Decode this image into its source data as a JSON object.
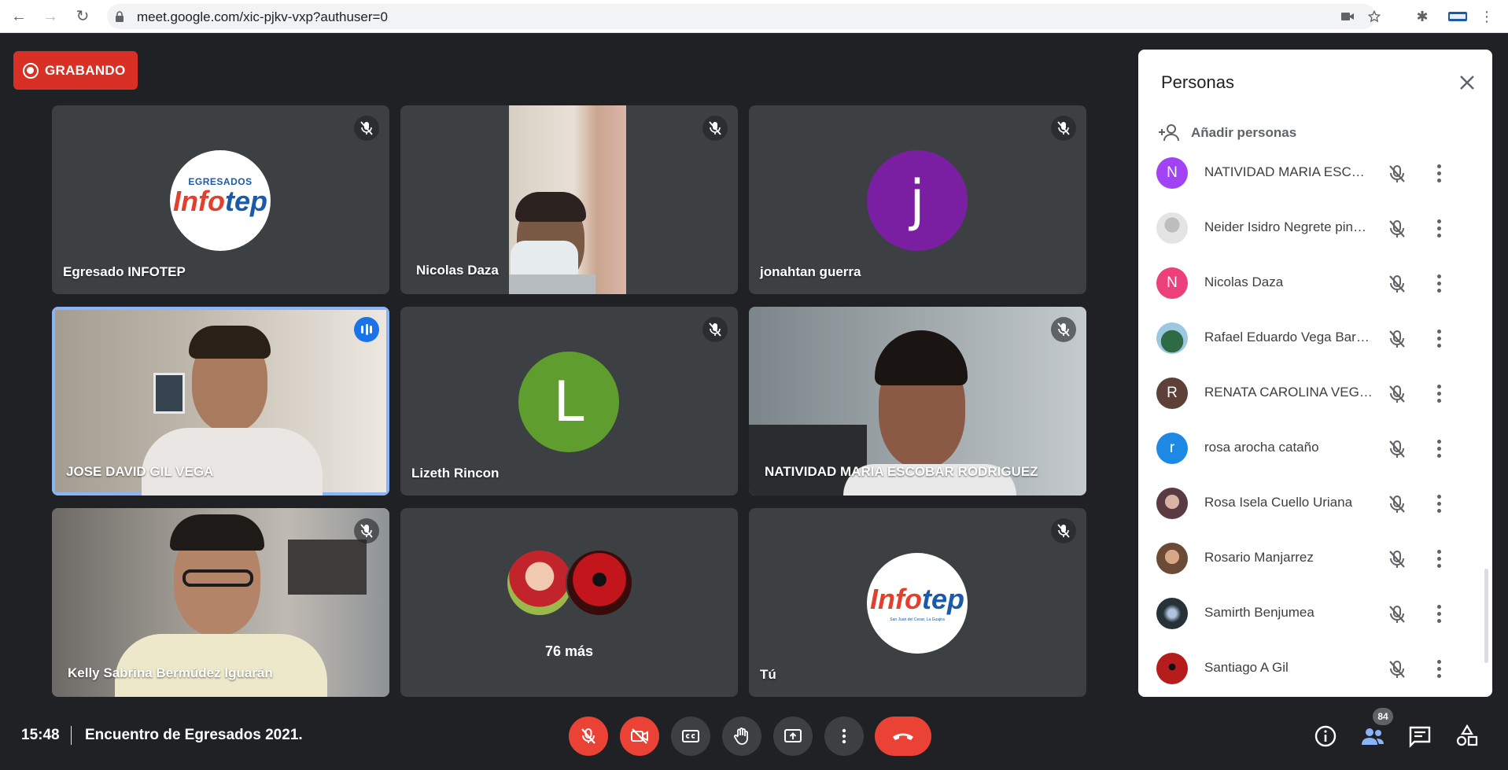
{
  "browser": {
    "url": "meet.google.com/xic-pjkv-vxp?authuser=0"
  },
  "recording": {
    "label": "GRABANDO"
  },
  "tiles": [
    {
      "name": "Egresado INFOTEP",
      "logo_top": "EGRESADOS",
      "logo_a": "Info",
      "logo_b": "tep"
    },
    {
      "name": "Nicolas Daza"
    },
    {
      "name": "jonahtan guerra",
      "initial": "j",
      "color": "#7b1fa2"
    },
    {
      "name": "JOSE DAVID GIL VEGA"
    },
    {
      "name": "Lizeth Rincon",
      "initial": "L",
      "color": "#5e9d2e"
    },
    {
      "name": "NATIVIDAD MARIA ESCOBAR RODRIGUEZ"
    },
    {
      "name": "Kelly Sabrina Bermúdez Iguarán"
    },
    {
      "name": "76 más"
    },
    {
      "name": "Tú",
      "logo_a": "Info",
      "logo_b": "tep",
      "logo_sub": "San Juan del Cesar, La Guajira"
    }
  ],
  "panel": {
    "title": "Personas",
    "add_label": "Añadir personas",
    "people": [
      {
        "name": "NATIVIDAD MARIA ESCOBAR RODRIGUEZ",
        "initial": "N",
        "color": "#a142f4"
      },
      {
        "name": "Neider Isidro Negrete pineda",
        "initial": "",
        "color": "#c9c9c9"
      },
      {
        "name": "Nicolas Daza",
        "initial": "N",
        "color": "#ec407a"
      },
      {
        "name": "Rafael Eduardo Vega Barboza",
        "initial": "",
        "color": "#3e7b57"
      },
      {
        "name": "RENATA CAROLINA VEGA GIL",
        "initial": "R",
        "color": "#5d4037"
      },
      {
        "name": "rosa arocha cataño",
        "initial": "r",
        "color": "#1e88e5"
      },
      {
        "name": "Rosa Isela Cuello Uriana",
        "initial": "",
        "color": "#8d6e7a"
      },
      {
        "name": "Rosario Manjarrez",
        "initial": "",
        "color": "#a1887f"
      },
      {
        "name": "Samirth Benjumea",
        "initial": "",
        "color": "#263238"
      },
      {
        "name": "Santiago A Gil",
        "initial": "",
        "color": "#b71c1c"
      }
    ]
  },
  "bottom": {
    "time": "15:48",
    "meeting_title": "Encuentro de Egresados 2021.",
    "participants_count": "84"
  }
}
